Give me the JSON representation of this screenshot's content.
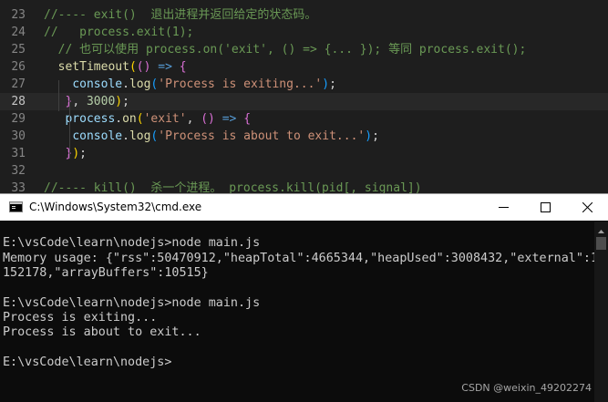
{
  "editor": {
    "line_numbers": [
      "23",
      "24",
      "25",
      "26",
      "27",
      "28",
      "29",
      "30",
      "31",
      "32",
      "33"
    ],
    "lines": [
      [
        {
          "t": "//---- exit()  退出进程并返回给定的状态码。",
          "c": "com"
        }
      ],
      [
        {
          "t": "//   process.exit(1);",
          "c": "com"
        }
      ],
      [
        {
          "t": "  // 也可以使用 process.on('exit', () => {... }); 等同 process.exit();",
          "c": "com"
        }
      ],
      [
        {
          "t": "  ",
          "c": ""
        },
        {
          "t": "setTimeout",
          "c": "fn"
        },
        {
          "t": "(",
          "c": "p1"
        },
        {
          "t": "()",
          "c": "p2"
        },
        {
          "t": " ",
          "c": ""
        },
        {
          "t": "=>",
          "c": "kw"
        },
        {
          "t": " ",
          "c": ""
        },
        {
          "t": "{",
          "c": "p2"
        }
      ],
      [
        {
          "t": "    ",
          "c": ""
        },
        {
          "t": "console",
          "c": "var"
        },
        {
          "t": ".",
          "c": ""
        },
        {
          "t": "log",
          "c": "fn"
        },
        {
          "t": "(",
          "c": "p3"
        },
        {
          "t": "'Process is exiting...'",
          "c": "str"
        },
        {
          "t": ")",
          "c": "p3"
        },
        {
          "t": ";",
          "c": ""
        }
      ],
      [
        {
          "t": "   ",
          "c": ""
        },
        {
          "t": "}",
          "c": "p2"
        },
        {
          "t": ", ",
          "c": ""
        },
        {
          "t": "3000",
          "c": "num"
        },
        {
          "t": ")",
          "c": "p1"
        },
        {
          "t": ";",
          "c": ""
        }
      ],
      [
        {
          "t": "   ",
          "c": ""
        },
        {
          "t": "process",
          "c": "var"
        },
        {
          "t": ".",
          "c": ""
        },
        {
          "t": "on",
          "c": "fn"
        },
        {
          "t": "(",
          "c": "p1"
        },
        {
          "t": "'exit'",
          "c": "str"
        },
        {
          "t": ", ",
          "c": ""
        },
        {
          "t": "()",
          "c": "p2"
        },
        {
          "t": " ",
          "c": ""
        },
        {
          "t": "=>",
          "c": "kw"
        },
        {
          "t": " ",
          "c": ""
        },
        {
          "t": "{",
          "c": "p2"
        }
      ],
      [
        {
          "t": "    ",
          "c": ""
        },
        {
          "t": "console",
          "c": "var"
        },
        {
          "t": ".",
          "c": ""
        },
        {
          "t": "log",
          "c": "fn"
        },
        {
          "t": "(",
          "c": "p3"
        },
        {
          "t": "'Process is about to exit...'",
          "c": "str"
        },
        {
          "t": ")",
          "c": "p3"
        },
        {
          "t": ";",
          "c": ""
        }
      ],
      [
        {
          "t": "   ",
          "c": ""
        },
        {
          "t": "}",
          "c": "p2"
        },
        {
          "t": ")",
          "c": "p1"
        },
        {
          "t": ";",
          "c": ""
        }
      ],
      [
        {
          "t": "",
          "c": ""
        }
      ],
      [
        {
          "t": "//---- kill()  杀一个进程。 process.kill(pid[, signal])",
          "c": "com"
        }
      ]
    ],
    "current_line_index": 5
  },
  "cmd_window": {
    "title": "C:\\Windows\\System32\\cmd.exe",
    "icon": "cmd-icon",
    "minimize_icon": "minimize-icon",
    "maximize_icon": "maximize-icon",
    "close_icon": "close-icon"
  },
  "console": {
    "lines": [
      "",
      "E:\\vsCode\\learn\\nodejs>node main.js",
      "Memory usage: {\"rss\":50470912,\"heapTotal\":4665344,\"heapUsed\":3008432,\"external\":1",
      "152178,\"arrayBuffers\":10515}",
      "",
      "E:\\vsCode\\learn\\nodejs>node main.js",
      "Process is exiting...",
      "Process is about to exit...",
      "",
      "E:\\vsCode\\learn\\nodejs>"
    ]
  },
  "watermark": "CSDN @weixin_49202274"
}
